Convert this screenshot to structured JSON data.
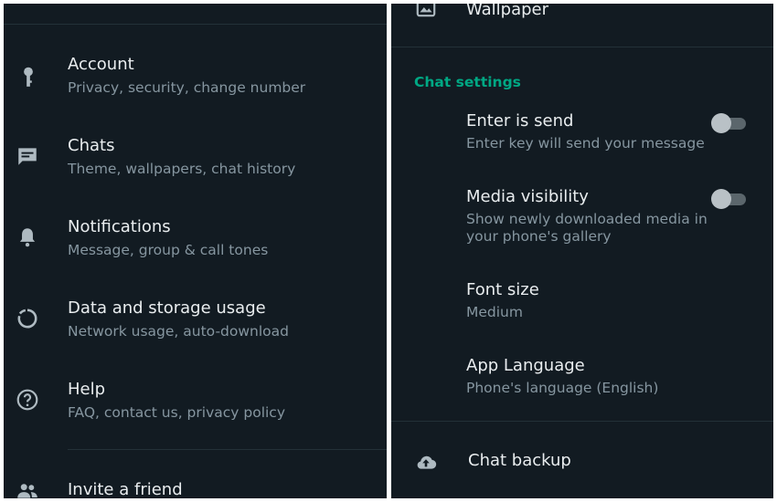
{
  "left": {
    "items": [
      {
        "title": "Account",
        "subtitle": "Privacy, security, change number",
        "icon": "key-icon"
      },
      {
        "title": "Chats",
        "subtitle": "Theme, wallpapers, chat history",
        "icon": "chat-icon"
      },
      {
        "title": "Notifications",
        "subtitle": "Message, group & call tones",
        "icon": "bell-icon"
      },
      {
        "title": "Data and storage usage",
        "subtitle": "Network usage, auto-download",
        "icon": "data-usage-icon"
      },
      {
        "title": "Help",
        "subtitle": "FAQ, contact us, privacy policy",
        "icon": "help-icon"
      }
    ],
    "invite": {
      "title": "Invite a friend",
      "icon": "group-icon"
    }
  },
  "right": {
    "wallpaper": {
      "title": "Wallpaper",
      "icon": "wallpaper-icon"
    },
    "section_header": "Chat settings",
    "enter_is_send": {
      "title": "Enter is send",
      "subtitle": "Enter key will send your message",
      "enabled": false
    },
    "media_visibility": {
      "title": "Media visibility",
      "subtitle_line1": "Show newly downloaded media in",
      "subtitle_line2": "your phone's gallery",
      "enabled": false
    },
    "font_size": {
      "title": "Font size",
      "value": "Medium"
    },
    "app_language": {
      "title": "App Language",
      "value": "Phone's language (English)"
    },
    "chat_backup": {
      "title": "Chat backup",
      "icon": "cloud-upload-icon"
    }
  },
  "colors": {
    "background": "#121b22",
    "primary_text": "#e9edef",
    "secondary_text": "#8696a0",
    "accent": "#00a884",
    "icon": "#aebac1"
  }
}
